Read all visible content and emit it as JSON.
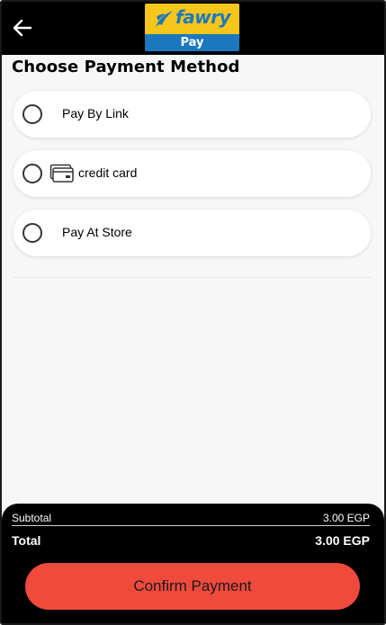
{
  "header": {
    "back_icon": "arrow-left-icon",
    "logo": {
      "word": "fawry",
      "sub": "Pay",
      "colors": {
        "yellow": "#f5c61c",
        "blue": "#1b78bd"
      }
    }
  },
  "title": "Choose Payment Method",
  "options": [
    {
      "label": "Pay By Link",
      "icon": null,
      "selected": false
    },
    {
      "label": "credit card",
      "icon": "credit-card-icon",
      "selected": false
    },
    {
      "label": "Pay At Store",
      "icon": null,
      "selected": false
    }
  ],
  "summary": {
    "subtotal_label": "Subtotal",
    "subtotal_value": "3.00 EGP",
    "total_label": "Total",
    "total_value": "3.00 EGP"
  },
  "confirm_label": "Confirm Payment",
  "colors": {
    "accent": "#f04a3d",
    "header_bg": "#000000",
    "footer_bg": "#000000"
  }
}
